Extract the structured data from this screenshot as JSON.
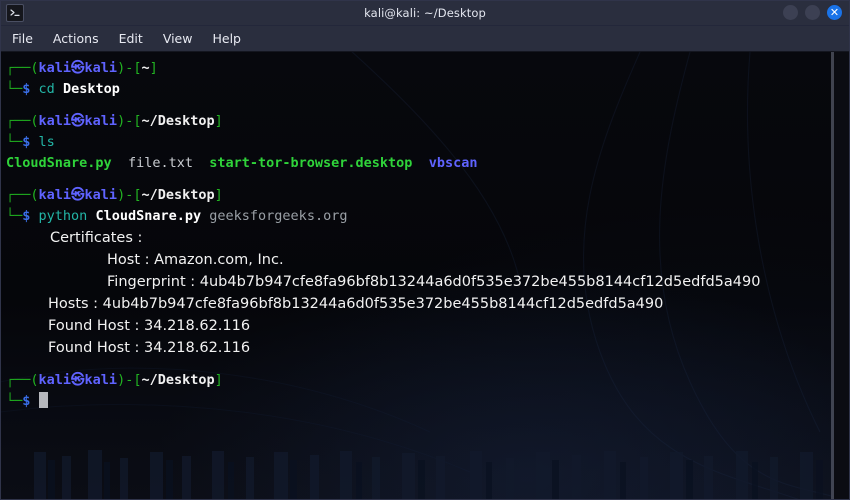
{
  "window": {
    "title": "kali@kali: ~/Desktop",
    "icon": "terminal-icon",
    "controls": {
      "minimize": "",
      "maximize": "",
      "close": "✕"
    }
  },
  "menu": {
    "items": [
      {
        "label": "File"
      },
      {
        "label": "Actions"
      },
      {
        "label": "Edit"
      },
      {
        "label": "View"
      },
      {
        "label": "Help"
      }
    ]
  },
  "terminal": {
    "prompt": {
      "top_deco": "┌──",
      "bottom_deco": "└─",
      "open_paren": "(",
      "close_paren": ")",
      "user": "kali",
      "at_symbol": "㉿",
      "host": "kali",
      "dash": "-",
      "open_bracket": "[",
      "close_bracket": "]",
      "dollar": "$"
    },
    "blocks": [
      {
        "path": "~",
        "command": "cd",
        "args": "Desktop"
      },
      {
        "path": "~/Desktop",
        "command": "ls",
        "args": ""
      },
      {
        "path": "~/Desktop",
        "command": "python",
        "args": "CloudSnare.py",
        "args2": "geeksforgeeks.org"
      },
      {
        "path": "~/Desktop",
        "command": "",
        "args": ""
      }
    ],
    "ls_output": [
      {
        "name": "CloudSnare.py",
        "type": "executable"
      },
      {
        "name": "file.txt",
        "type": "file"
      },
      {
        "name": "start-tor-browser.desktop",
        "type": "executable"
      },
      {
        "name": "vbscan",
        "type": "directory"
      }
    ],
    "program_output": [
      {
        "indent": 0,
        "text": "Certificates :"
      },
      {
        "indent": 2,
        "text": "Host : Amazon.com, Inc."
      },
      {
        "indent": 2,
        "text": "Fingerprint : 4ub4b7b947cfe8fa96bf8b13244a6d0f535e372be455b8144cf12d5edfd5a490"
      },
      {
        "indent": 0,
        "text": "Hosts : 4ub4b7b947cfe8fa96bf8b13244a6d0f535e372be455b8144cf12d5edfd5a490"
      },
      {
        "indent": 0,
        "text": "Found Host : 34.218.62.116"
      },
      {
        "indent": 0,
        "text": "Found Host : 34.218.62.116"
      }
    ]
  },
  "colors": {
    "titlebar_bg": "#2a2e3e",
    "terminal_bg": "#020204",
    "prompt_deco": "#1ea61e",
    "prompt_user": "#5f63ff",
    "prompt_path": "#f0f0f0",
    "dollar": "#3a6fe8",
    "command": "#23b5a6",
    "close_button": "#1a73e8",
    "output_text": "#f2f2f2",
    "dir_color": "#5f63ff",
    "exec_color": "#2fd33a"
  }
}
